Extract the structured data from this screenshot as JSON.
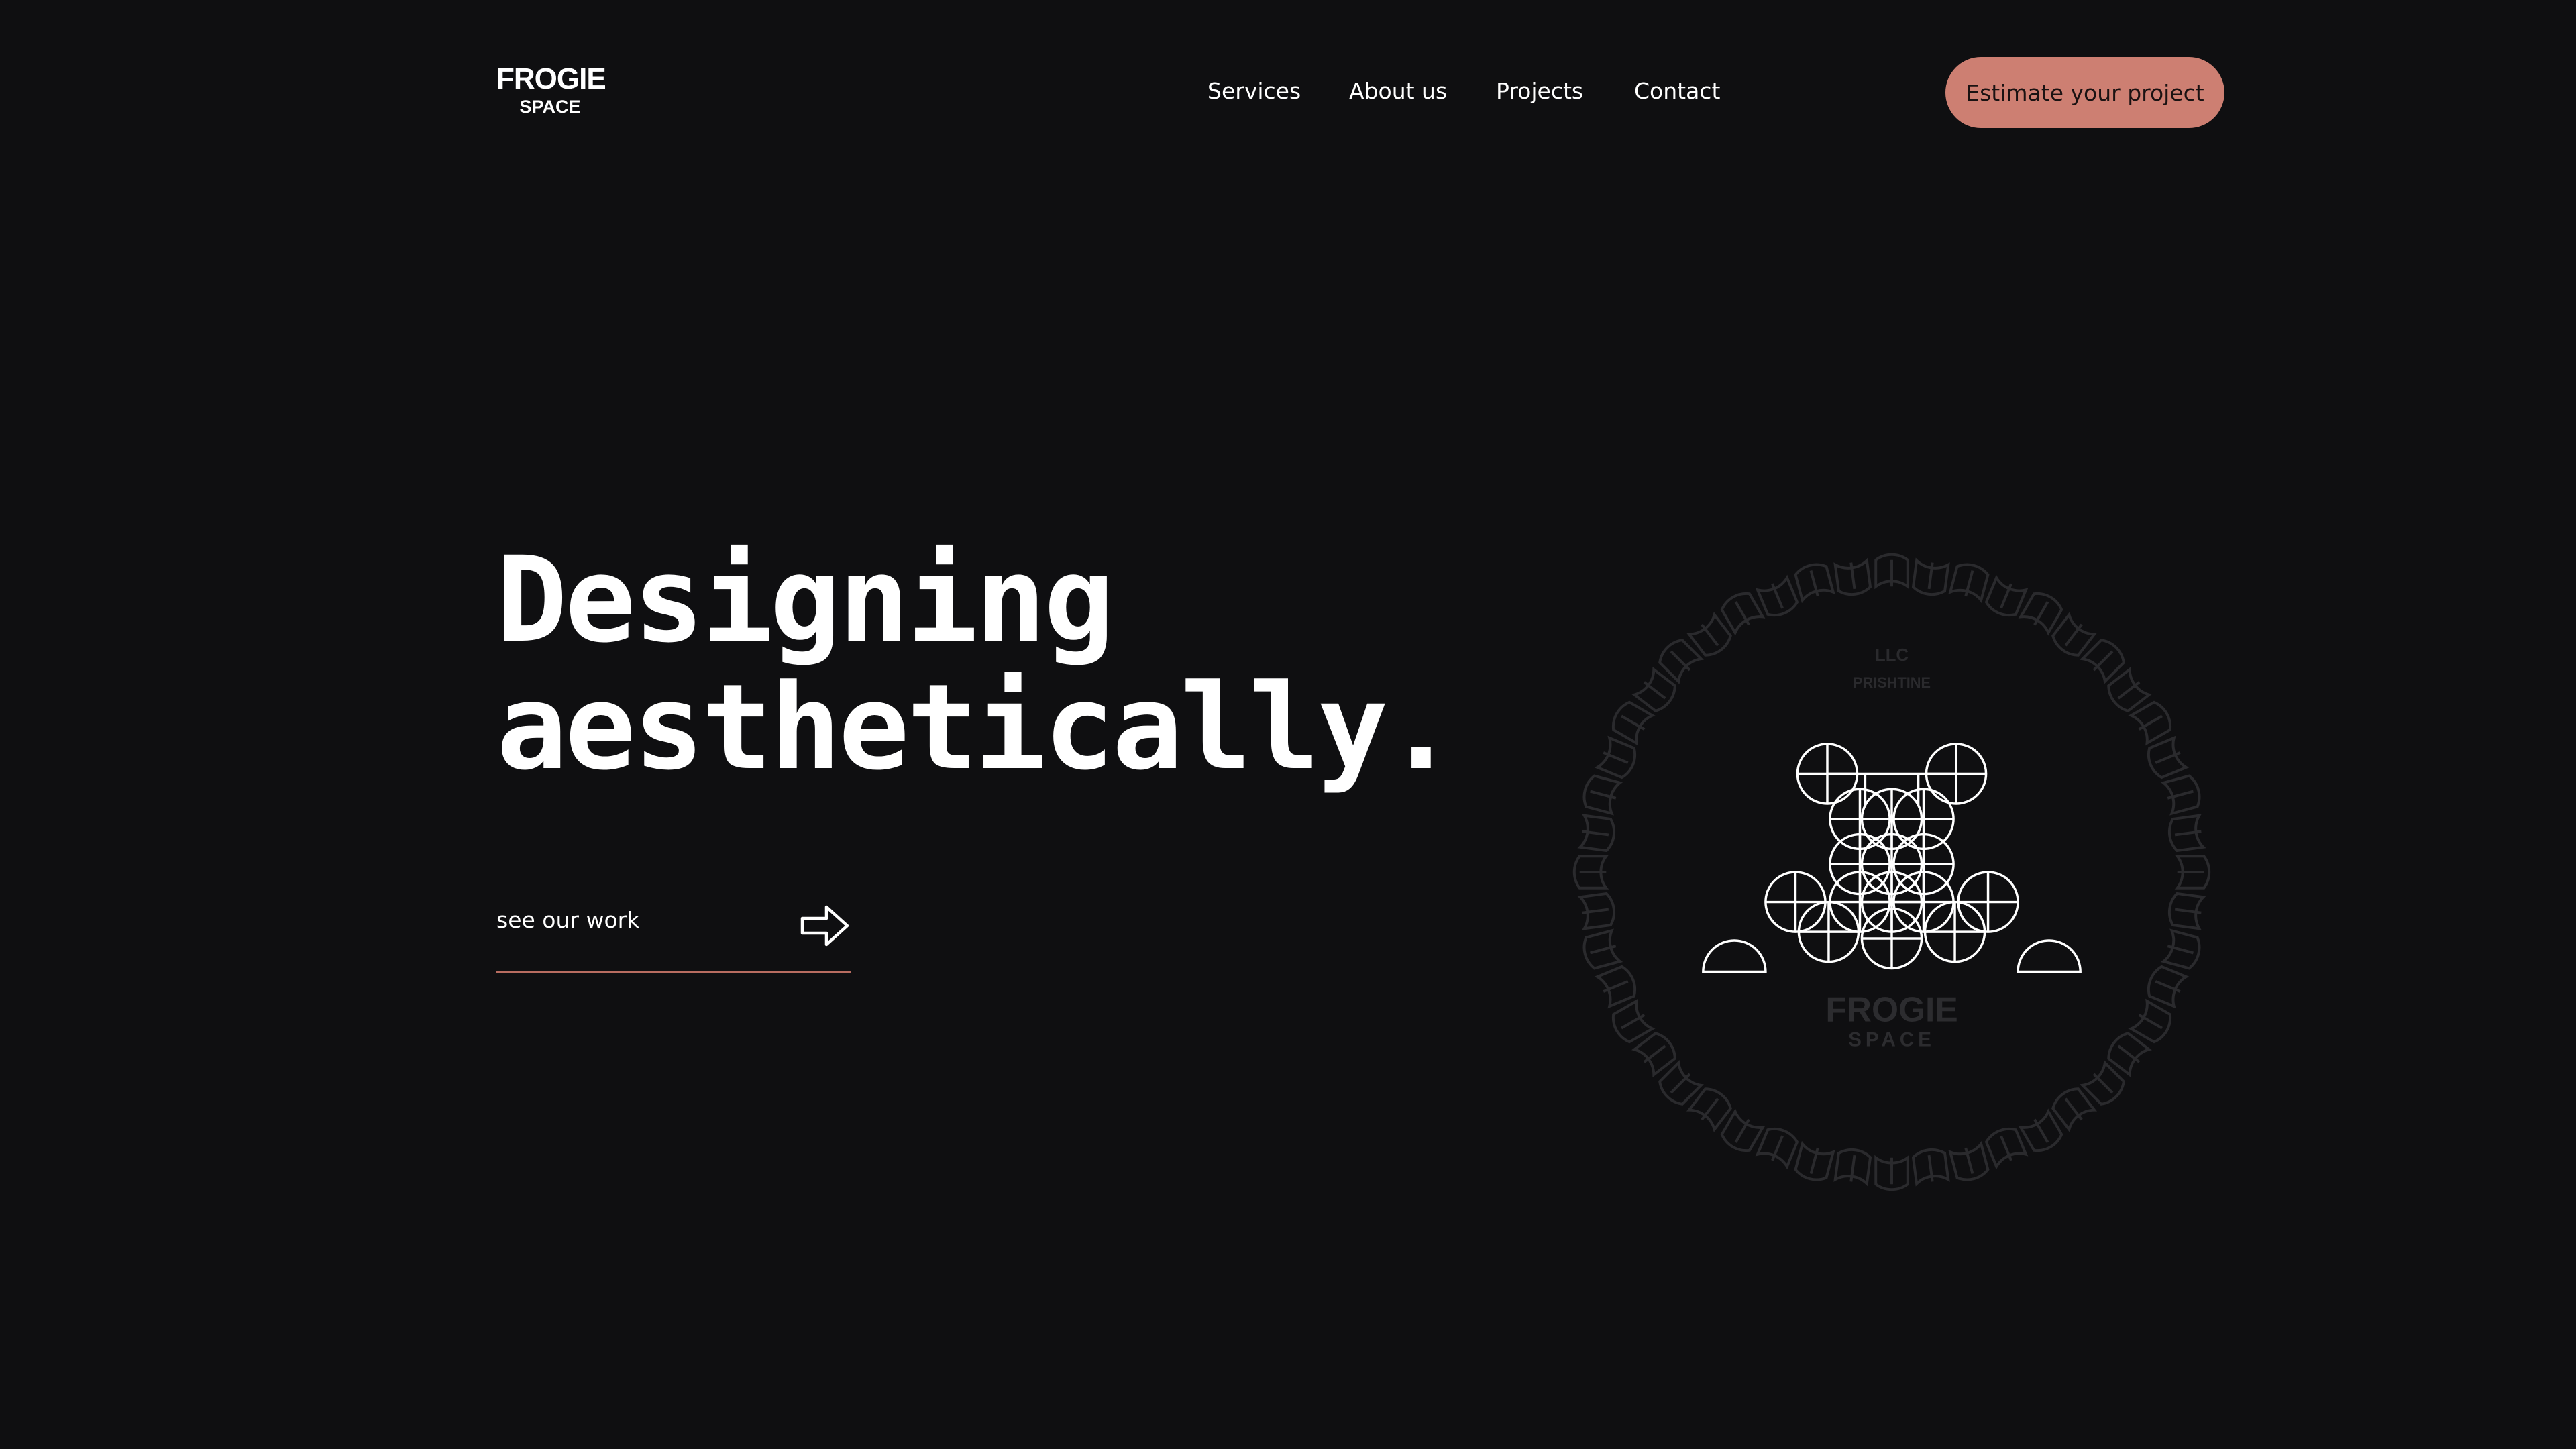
{
  "header": {
    "logo": {
      "line1": "FROGIE",
      "line2": "SPACE"
    },
    "nav": [
      {
        "label": "Services"
      },
      {
        "label": "About us"
      },
      {
        "label": "Projects"
      },
      {
        "label": "Contact"
      }
    ],
    "cta_label": "Estimate your project"
  },
  "hero": {
    "title_line1": "Designing",
    "title_line2": "aesthetically.",
    "link_label": "see our work"
  },
  "emblem": {
    "top_line1": "LLC",
    "top_line2": "PRISHTINE",
    "bottom_line1": "FROGIE",
    "bottom_line2": "SPACE"
  },
  "colors": {
    "background": "#0f0f11",
    "accent": "#cd7f72",
    "underline": "#b86c60",
    "text": "#ffffff",
    "emblem_faint": "#2a2a2d"
  }
}
